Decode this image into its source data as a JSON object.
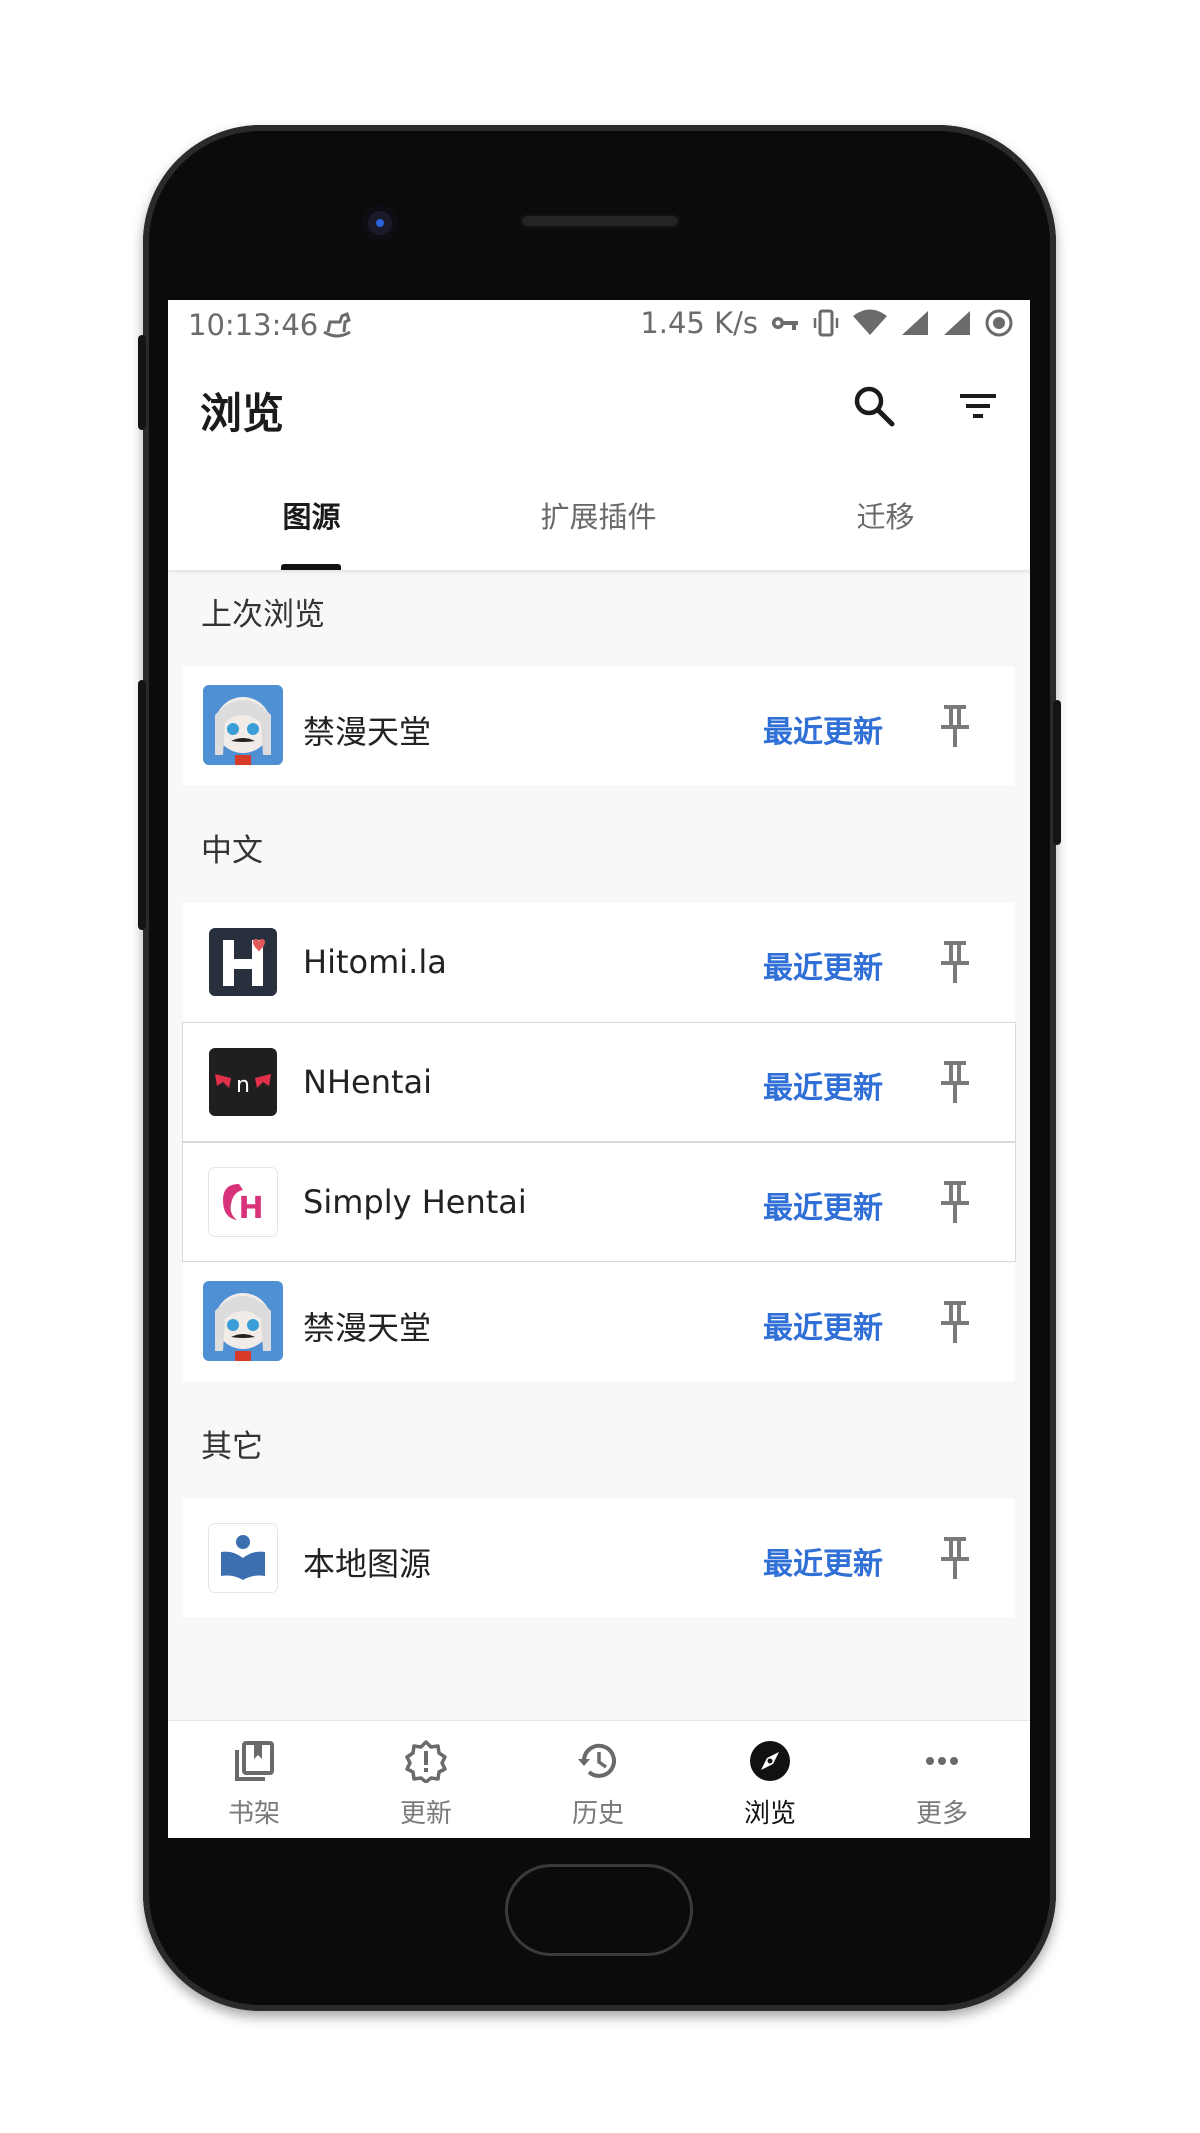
{
  "status_bar": {
    "time": "10:13:46",
    "net_speed": "1.45 K/s"
  },
  "app_bar": {
    "title": "浏览"
  },
  "tabs": [
    {
      "label": "图源",
      "active": true
    },
    {
      "label": "扩展插件",
      "active": false
    },
    {
      "label": "迁移",
      "active": false
    }
  ],
  "sections": {
    "last_browsed": {
      "header": "上次浏览",
      "items": [
        {
          "name": "禁漫天堂",
          "action": "最近更新"
        }
      ]
    },
    "chinese": {
      "header": "中文",
      "items": [
        {
          "name": "Hitomi.la",
          "action": "最近更新"
        },
        {
          "name": "NHentai",
          "action": "最近更新"
        },
        {
          "name": "Simply Hentai",
          "action": "最近更新"
        },
        {
          "name": "禁漫天堂",
          "action": "最近更新"
        }
      ]
    },
    "other": {
      "header": "其它",
      "items": [
        {
          "name": "本地图源",
          "action": "最近更新"
        }
      ]
    }
  },
  "bottom_nav": [
    {
      "label": "书架",
      "icon": "library-icon",
      "active": false
    },
    {
      "label": "更新",
      "icon": "alert-badge-icon",
      "active": false
    },
    {
      "label": "历史",
      "icon": "history-icon",
      "active": false
    },
    {
      "label": "浏览",
      "icon": "compass-icon",
      "active": true
    },
    {
      "label": "更多",
      "icon": "more-horiz-icon",
      "active": false
    }
  ],
  "colors": {
    "accent_blue": "#2f6fd6",
    "screen_background": "#f8f8f8"
  },
  "text_labels": [
    "n",
    "H"
  ]
}
